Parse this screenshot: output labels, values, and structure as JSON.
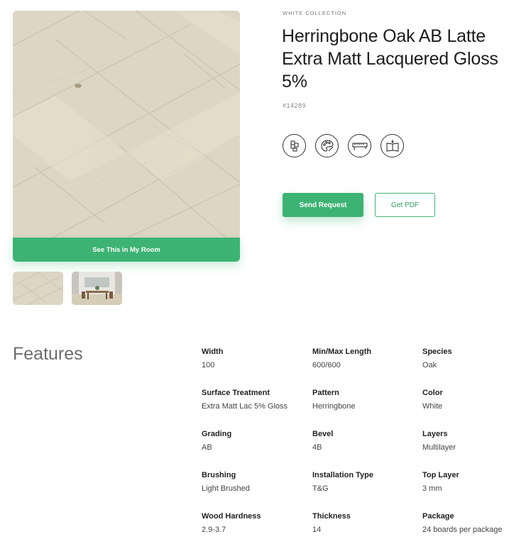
{
  "product": {
    "collection": "WHITE COLLECTION",
    "title": "Herringbone Oak AB Latte Extra Matt Lacquered Gloss 5%",
    "sku": "#14289"
  },
  "colors": {
    "accent": "#3db373",
    "wood_light": "#e4ddcb",
    "wood_mid": "#d8d0bb"
  },
  "media": {
    "room_button_label": "See This in My Room",
    "thumbnails": [
      "floor-sample-thumbnail",
      "room-scene-thumbnail"
    ]
  },
  "feature_icons": [
    "plank-pattern-icon",
    "color-palette-icon",
    "tape-measure-icon",
    "brochure-book-icon"
  ],
  "actions": {
    "send_request_label": "Send Request",
    "get_pdf_label": "Get PDF"
  },
  "features": {
    "heading": "Features",
    "specs": [
      {
        "label": "Width",
        "value": "100"
      },
      {
        "label": "Min/Max Length",
        "value": "600/600"
      },
      {
        "label": "Species",
        "value": "Oak"
      },
      {
        "label": "Surface Treatment",
        "value": "Extra Matt Lac 5% Gloss"
      },
      {
        "label": "Pattern",
        "value": "Herringbone"
      },
      {
        "label": "Color",
        "value": "White"
      },
      {
        "label": "Grading",
        "value": "AB"
      },
      {
        "label": "Bevel",
        "value": "4B"
      },
      {
        "label": "Layers",
        "value": "Multilayer"
      },
      {
        "label": "Brushing",
        "value": "Light Brushed"
      },
      {
        "label": "Installation Type",
        "value": "T&G"
      },
      {
        "label": "Top Layer",
        "value": "3 mm"
      },
      {
        "label": "Wood Hardness",
        "value": "2.9-3.7"
      },
      {
        "label": "Thickness",
        "value": "14"
      },
      {
        "label": "Package",
        "value": "24 boards per package"
      }
    ]
  }
}
